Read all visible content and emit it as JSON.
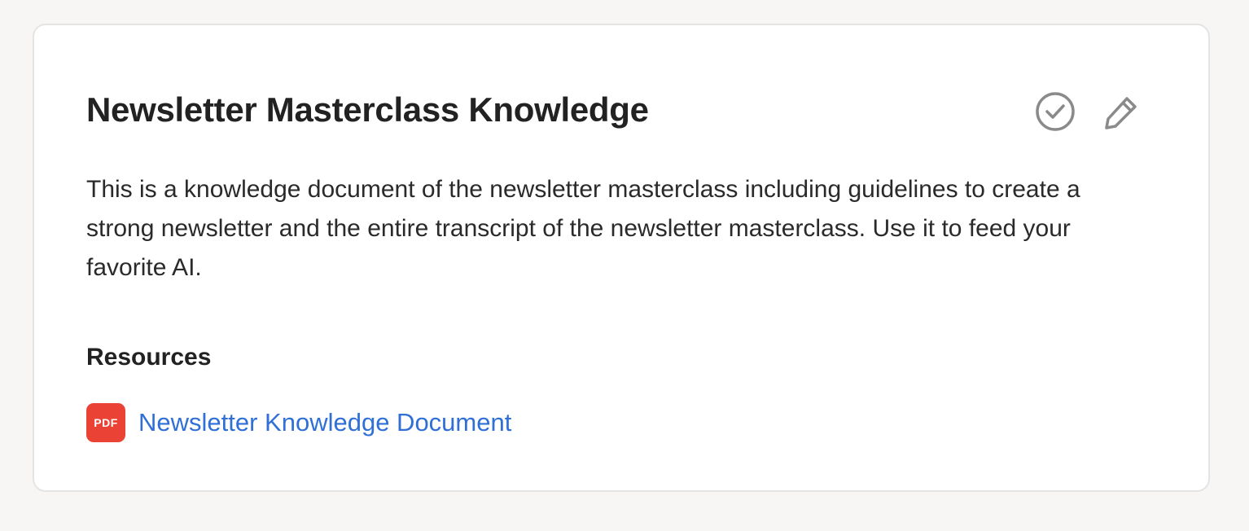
{
  "card": {
    "title": "Newsletter Masterclass Knowledge",
    "description": "This is a knowledge document of the newsletter masterclass including guidelines to create a strong newsletter and the entire transcript of the newsletter masterclass. Use it to feed your favorite AI.",
    "actions": {
      "complete_icon": "check-circle-icon",
      "edit_icon": "pencil-icon"
    },
    "resources": {
      "heading": "Resources",
      "items": [
        {
          "file_type": "PDF",
          "label": "Newsletter Knowledge Document",
          "icon": "pdf-file-icon"
        }
      ]
    }
  },
  "colors": {
    "background": "#f7f6f4",
    "card": "#ffffff",
    "title_text": "#222222",
    "link": "#2f6fd6",
    "pdf_badge": "#ea4335",
    "icon_gray": "#8a8a8a"
  }
}
